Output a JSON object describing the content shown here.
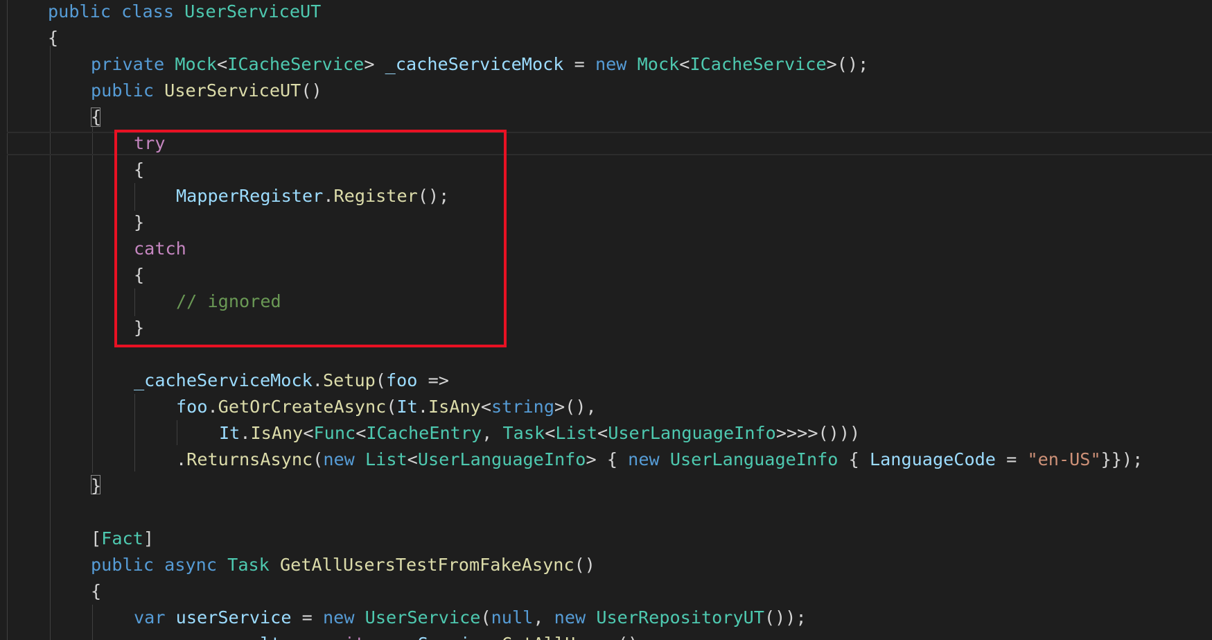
{
  "editor": {
    "lines": [
      [
        {
          "t": "public",
          "c": "kw"
        },
        {
          "t": " "
        },
        {
          "t": "class",
          "c": "kw"
        },
        {
          "t": " "
        },
        {
          "t": "UserServiceUT",
          "c": "type"
        }
      ],
      [
        {
          "t": "{",
          "c": "pun"
        }
      ],
      [
        {
          "t": "private",
          "c": "kw"
        },
        {
          "t": " "
        },
        {
          "t": "Mock",
          "c": "type"
        },
        {
          "t": "<",
          "c": "pun"
        },
        {
          "t": "ICacheService",
          "c": "type"
        },
        {
          "t": "> ",
          "c": "pun"
        },
        {
          "t": "_cacheServiceMock",
          "c": "var"
        },
        {
          "t": " = ",
          "c": "pun"
        },
        {
          "t": "new",
          "c": "kw"
        },
        {
          "t": " "
        },
        {
          "t": "Mock",
          "c": "type"
        },
        {
          "t": "<",
          "c": "pun"
        },
        {
          "t": "ICacheService",
          "c": "type"
        },
        {
          "t": ">();",
          "c": "pun"
        }
      ],
      [
        {
          "t": "public",
          "c": "kw"
        },
        {
          "t": " "
        },
        {
          "t": "UserServiceUT",
          "c": "fn"
        },
        {
          "t": "()",
          "c": "pun"
        }
      ],
      [
        {
          "t": "{",
          "c": "pun"
        }
      ],
      [
        {
          "t": "try",
          "c": "ctl"
        }
      ],
      [
        {
          "t": "{",
          "c": "pun"
        }
      ],
      [
        {
          "t": "MapperRegister",
          "c": "var"
        },
        {
          "t": ".",
          "c": "pun"
        },
        {
          "t": "Register",
          "c": "fn"
        },
        {
          "t": "();",
          "c": "pun"
        }
      ],
      [
        {
          "t": "}",
          "c": "pun"
        }
      ],
      [
        {
          "t": "catch",
          "c": "ctl"
        }
      ],
      [
        {
          "t": "{",
          "c": "pun"
        }
      ],
      [
        {
          "t": "// ignored",
          "c": "cmt"
        }
      ],
      [
        {
          "t": "}",
          "c": "pun"
        }
      ],
      [],
      [
        {
          "t": "_cacheServiceMock",
          "c": "var"
        },
        {
          "t": ".",
          "c": "pun"
        },
        {
          "t": "Setup",
          "c": "fn"
        },
        {
          "t": "(",
          "c": "pun"
        },
        {
          "t": "foo",
          "c": "var"
        },
        {
          "t": " =>",
          "c": "pun"
        }
      ],
      [
        {
          "t": "foo",
          "c": "var"
        },
        {
          "t": ".",
          "c": "pun"
        },
        {
          "t": "GetOrCreateAsync",
          "c": "fn"
        },
        {
          "t": "(",
          "c": "pun"
        },
        {
          "t": "It",
          "c": "var"
        },
        {
          "t": ".",
          "c": "pun"
        },
        {
          "t": "IsAny",
          "c": "fn"
        },
        {
          "t": "<",
          "c": "pun"
        },
        {
          "t": "string",
          "c": "kw"
        },
        {
          "t": ">(),",
          "c": "pun"
        }
      ],
      [
        {
          "t": "It",
          "c": "var"
        },
        {
          "t": ".",
          "c": "pun"
        },
        {
          "t": "IsAny",
          "c": "fn"
        },
        {
          "t": "<",
          "c": "pun"
        },
        {
          "t": "Func",
          "c": "type"
        },
        {
          "t": "<",
          "c": "pun"
        },
        {
          "t": "ICacheEntry",
          "c": "type"
        },
        {
          "t": ", ",
          "c": "pun"
        },
        {
          "t": "Task",
          "c": "type"
        },
        {
          "t": "<",
          "c": "pun"
        },
        {
          "t": "List",
          "c": "type"
        },
        {
          "t": "<",
          "c": "pun"
        },
        {
          "t": "UserLanguageInfo",
          "c": "type"
        },
        {
          "t": ">>>>()))",
          "c": "pun"
        }
      ],
      [
        {
          "t": ".",
          "c": "pun"
        },
        {
          "t": "ReturnsAsync",
          "c": "fn"
        },
        {
          "t": "(",
          "c": "pun"
        },
        {
          "t": "new",
          "c": "kw"
        },
        {
          "t": " "
        },
        {
          "t": "List",
          "c": "type"
        },
        {
          "t": "<",
          "c": "pun"
        },
        {
          "t": "UserLanguageInfo",
          "c": "type"
        },
        {
          "t": "> { ",
          "c": "pun"
        },
        {
          "t": "new",
          "c": "kw"
        },
        {
          "t": " "
        },
        {
          "t": "UserLanguageInfo",
          "c": "type"
        },
        {
          "t": " { ",
          "c": "pun"
        },
        {
          "t": "LanguageCode",
          "c": "var"
        },
        {
          "t": " = ",
          "c": "pun"
        },
        {
          "t": "\"en-US\"",
          "c": "str"
        },
        {
          "t": "}});",
          "c": "pun"
        }
      ],
      [
        {
          "t": "}",
          "c": "pun"
        }
      ],
      [],
      [
        {
          "t": "[",
          "c": "pun"
        },
        {
          "t": "Fact",
          "c": "type"
        },
        {
          "t": "]",
          "c": "pun"
        }
      ],
      [
        {
          "t": "public",
          "c": "kw"
        },
        {
          "t": " "
        },
        {
          "t": "async",
          "c": "kw"
        },
        {
          "t": " "
        },
        {
          "t": "Task",
          "c": "type"
        },
        {
          "t": " "
        },
        {
          "t": "GetAllUsersTestFromFakeAsync",
          "c": "fn"
        },
        {
          "t": "()",
          "c": "pun"
        }
      ],
      [
        {
          "t": "{",
          "c": "pun"
        }
      ],
      [
        {
          "t": "var",
          "c": "kw"
        },
        {
          "t": " "
        },
        {
          "t": "userService",
          "c": "var"
        },
        {
          "t": " = ",
          "c": "pun"
        },
        {
          "t": "new",
          "c": "kw"
        },
        {
          "t": " "
        },
        {
          "t": "UserService",
          "c": "type"
        },
        {
          "t": "(",
          "c": "pun"
        },
        {
          "t": "null",
          "c": "kw"
        },
        {
          "t": ", ",
          "c": "pun"
        },
        {
          "t": "new",
          "c": "kw"
        },
        {
          "t": " "
        },
        {
          "t": "UserRepositoryUT",
          "c": "type"
        },
        {
          "t": "());",
          "c": "pun"
        }
      ],
      [
        {
          "t": "var",
          "c": "kw"
        },
        {
          "t": " "
        },
        {
          "t": "result",
          "c": "var"
        },
        {
          "t": " = ",
          "c": "pun"
        },
        {
          "t": "await",
          "c": "ctl"
        },
        {
          "t": " "
        },
        {
          "t": "userService",
          "c": "var"
        },
        {
          "t": ".",
          "c": "pun"
        },
        {
          "t": "GetAllUsers",
          "c": "fn"
        },
        {
          "t": "();",
          "c": "pun"
        }
      ]
    ]
  }
}
